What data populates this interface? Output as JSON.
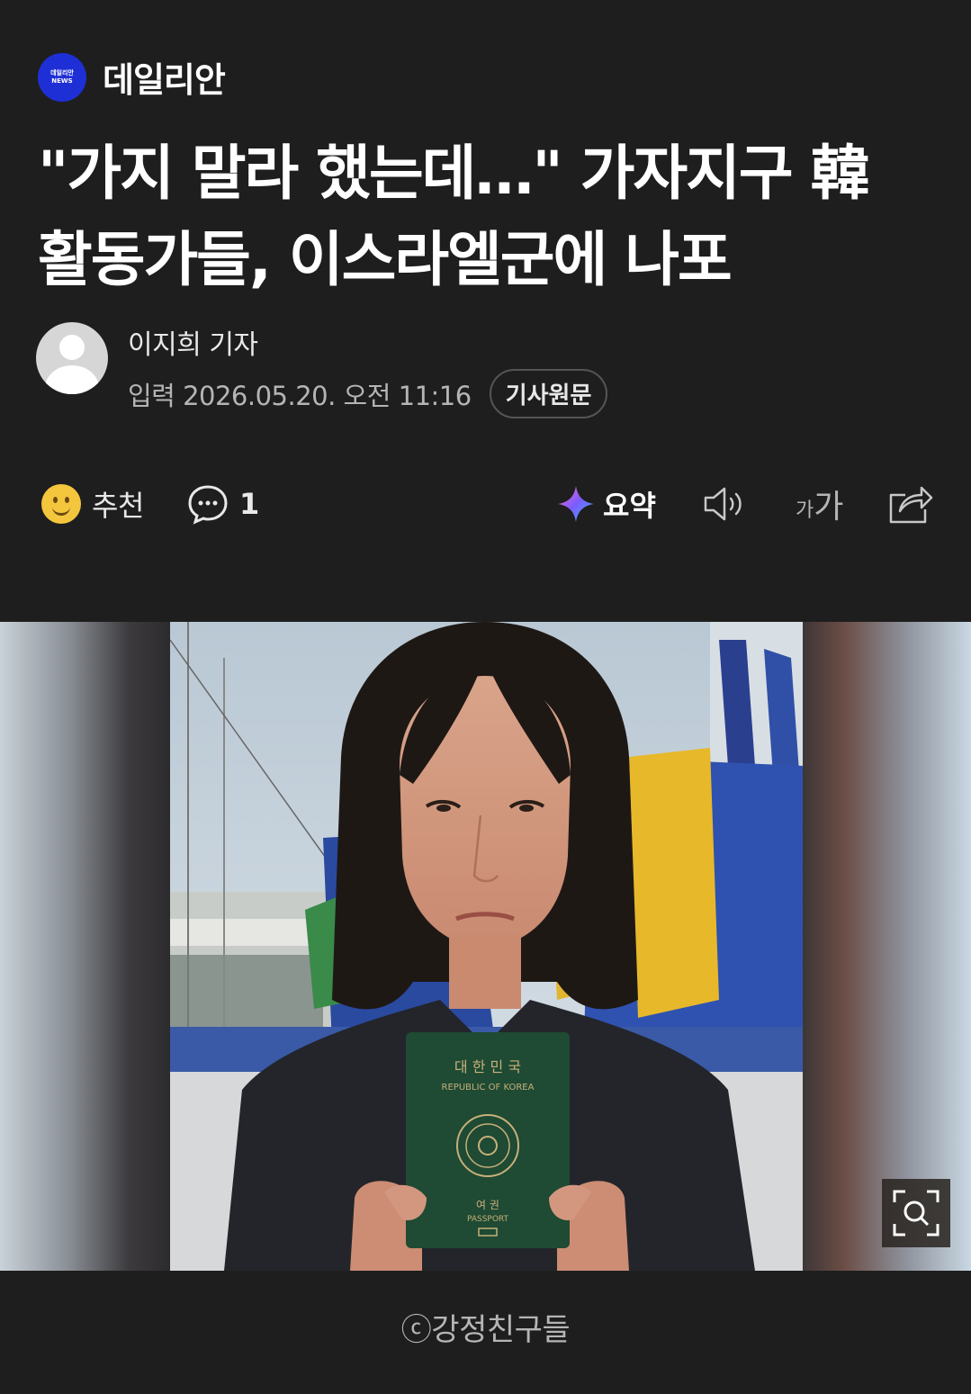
{
  "press": {
    "logo_text_1": "데일리안",
    "logo_text_2": "NEWS",
    "name": "데일리안"
  },
  "article": {
    "headline_line1": "\"가지 말라 했는데…\" 가자지구 韓",
    "headline_line2": "활동가들, 이스라엘군에 나포"
  },
  "byline": {
    "reporter": "이지희 기자",
    "date": "입력 2026.05.20. 오전 11:16",
    "original_button": "기사원문"
  },
  "toolbar": {
    "recommend_label": "추천",
    "comment_count": "1",
    "summary_label": "요약",
    "font_size_small": "가",
    "font_size_large": "가"
  },
  "photo": {
    "passport_title": "대 한 민 국",
    "passport_subtitle": "REPUBLIC OF KOREA",
    "passport_label_ko": "여 권",
    "passport_label_en": "PASSPORT",
    "caption": "ⓒ강정친구들"
  },
  "colors": {
    "background": "#1e1e1e",
    "press_logo": "#1f2fd6",
    "passport_green": "#1f4a33"
  }
}
